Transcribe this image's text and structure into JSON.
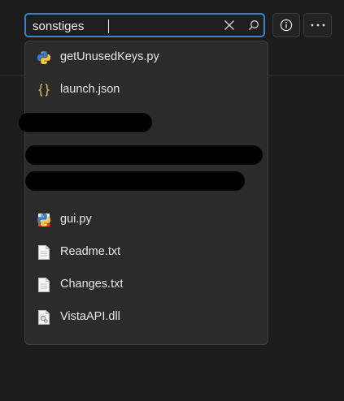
{
  "search": {
    "value": "sonstiges",
    "clear_title": "Clear",
    "search_title": "Search"
  },
  "toolbar": {
    "info_title": "Info",
    "more_title": "More"
  },
  "results": [
    {
      "name": "getUnusedKeys.py",
      "icon": "python-file-icon"
    },
    {
      "name": "launch.json",
      "icon": "json-file-icon"
    },
    {
      "name": "",
      "icon": "hidden"
    },
    {
      "name": "",
      "icon": "hidden"
    },
    {
      "name": "",
      "icon": "pdf-file-icon"
    },
    {
      "name": "gui.py",
      "icon": "python-file-icon"
    },
    {
      "name": "Readme.txt",
      "icon": "text-file-icon"
    },
    {
      "name": "Changes.txt",
      "icon": "text-file-icon"
    },
    {
      "name": "VistaAPI.dll",
      "icon": "dll-file-icon"
    },
    {
      "name": "",
      "icon": "partial-file-icon"
    }
  ],
  "colors": {
    "accent": "#3b82c4",
    "python_blue": "#3f7dbf",
    "python_yellow": "#f4c93a",
    "json_yellow": "#e5c33e",
    "pdf_red": "#d93b3b"
  }
}
